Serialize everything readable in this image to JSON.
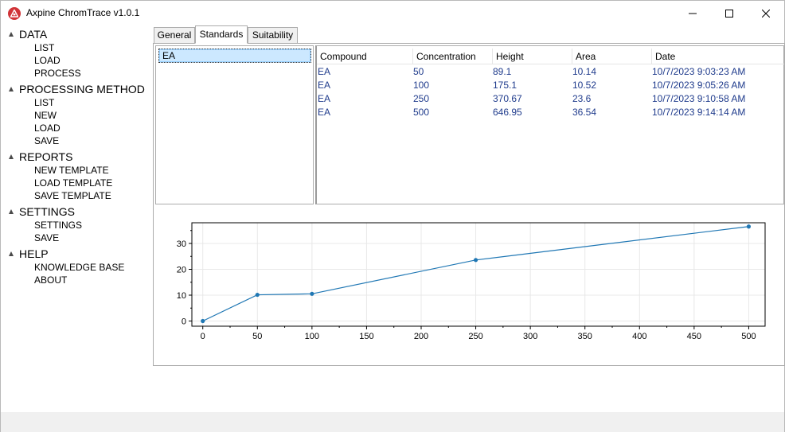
{
  "window": {
    "title": "Axpine ChromTrace v1.0.1"
  },
  "menu_tree": [
    {
      "label": "DATA",
      "items": [
        "LIST",
        "LOAD",
        "PROCESS"
      ]
    },
    {
      "label": "PROCESSING METHOD",
      "items": [
        "LIST",
        "NEW",
        "LOAD",
        "SAVE"
      ]
    },
    {
      "label": "REPORTS",
      "items": [
        "NEW TEMPLATE",
        "LOAD TEMPLATE",
        "SAVE TEMPLATE"
      ]
    },
    {
      "label": "SETTINGS",
      "items": [
        "SETTINGS",
        "SAVE"
      ]
    },
    {
      "label": "HELP",
      "items": [
        "KNOWLEDGE BASE",
        "ABOUT"
      ]
    }
  ],
  "tabs": [
    {
      "label": "General",
      "active": false
    },
    {
      "label": "Standards",
      "active": true
    },
    {
      "label": "Suitability",
      "active": false
    }
  ],
  "compound_list": {
    "items": [
      "EA"
    ],
    "selected": "EA"
  },
  "standards_table": {
    "columns": [
      "Compound",
      "Concentration",
      "Height",
      "Area",
      "Date"
    ],
    "rows": [
      [
        "EA",
        "50",
        "89.1",
        "10.14",
        "10/7/2023 9:03:23 AM"
      ],
      [
        "EA",
        "100",
        "175.1",
        "10.52",
        "10/7/2023 9:05:26 AM"
      ],
      [
        "EA",
        "250",
        "370.67",
        "23.6",
        "10/7/2023 9:10:58 AM"
      ],
      [
        "EA",
        "500",
        "646.95",
        "36.54",
        "10/7/2023 9:14:14 AM"
      ]
    ]
  },
  "chart_data": {
    "type": "line",
    "x": [
      0,
      50,
      100,
      250,
      500
    ],
    "y": [
      0,
      10.14,
      10.52,
      23.6,
      36.54
    ],
    "xlim": [
      -10,
      515
    ],
    "ylim": [
      -2,
      38
    ],
    "xticks": [
      0,
      50,
      100,
      150,
      200,
      250,
      300,
      350,
      400,
      450,
      500
    ],
    "yticks": [
      0,
      10,
      20,
      30
    ],
    "grid": true,
    "color": "#1f77b4",
    "title": "",
    "xlabel": "",
    "ylabel": ""
  },
  "colors": {
    "accent": "#d13438",
    "selection": "#cce8ff",
    "grid_text": "#1f3b8c"
  }
}
